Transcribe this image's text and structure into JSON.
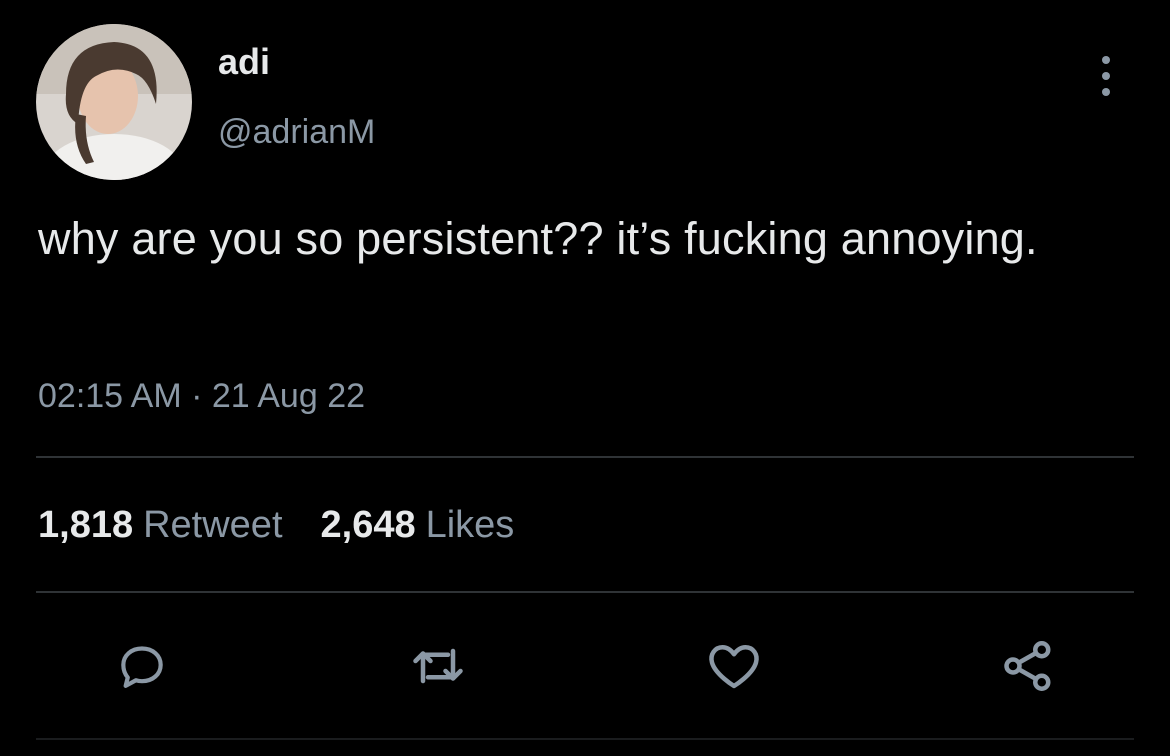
{
  "user": {
    "display_name": "adi",
    "handle": "@adrianM"
  },
  "tweet": {
    "text": "why are you so persistent?? it’s fucking annoying.",
    "timestamp": "02:15 AM · 21 Aug 22"
  },
  "stats": {
    "retweets_count": "1,818",
    "retweets_label": "Retweet",
    "likes_count": "2,648",
    "likes_label": "Likes"
  },
  "actions": {
    "reply_icon": "reply-icon",
    "retweet_icon": "retweet-icon",
    "like_icon": "heart-icon",
    "share_icon": "share-icon"
  },
  "colors": {
    "background": "#000000",
    "primary_text": "#e7e9ea",
    "secondary_text": "#8b98a5",
    "divider": "#2f3336"
  }
}
